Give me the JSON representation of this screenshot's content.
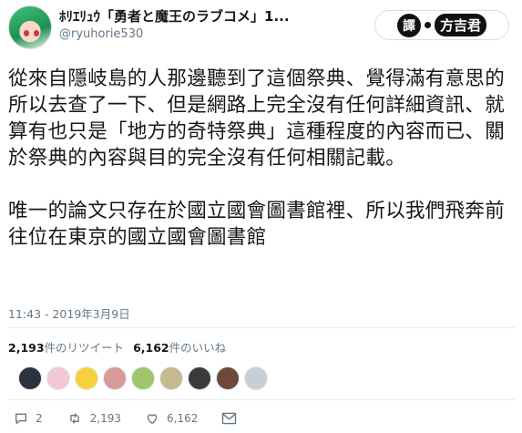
{
  "tweet": {
    "display_name": "ﾎﾘｴﾘｭｳ「勇者と魔王のラブコメ」1...",
    "handle": "@ryuhorie530",
    "paragraphs": [
      "從來自隱岐島的人那邊聽到了這個祭典、覺得滿有意思的所以去查了一下、但是網路上完全沒有任何詳細資訊、就算有也只是「地方的奇特祭典」這種程度的內容而已、關於祭典的內容與目的完全沒有任何相關記載。",
      "唯一的論文只存在於國立國會圖書館裡、所以我們飛奔前往位在東京的國立國會圖書館"
    ],
    "timestamp": "11:43 - 2019年3月9日"
  },
  "badge": {
    "char": "譯",
    "text": "方吉君"
  },
  "stats": {
    "retweets_count": "2,193",
    "retweets_label": "件のリツイート",
    "likes_count": "6,162",
    "likes_label": "件のいいね"
  },
  "likers": {
    "avatar_colors": [
      "#2b3240",
      "#f2c8d8",
      "#f5d23b",
      "#d99a9a",
      "#9fc46b",
      "#c7b98f",
      "#3b3b3b",
      "#6b4a3a",
      "#c6cfd8"
    ]
  },
  "actions": {
    "reply_count": "2",
    "retweet_count": "2,193",
    "like_count": "6,162"
  },
  "icons": [
    "reply-icon",
    "retweet-icon",
    "heart-icon",
    "mail-icon"
  ]
}
